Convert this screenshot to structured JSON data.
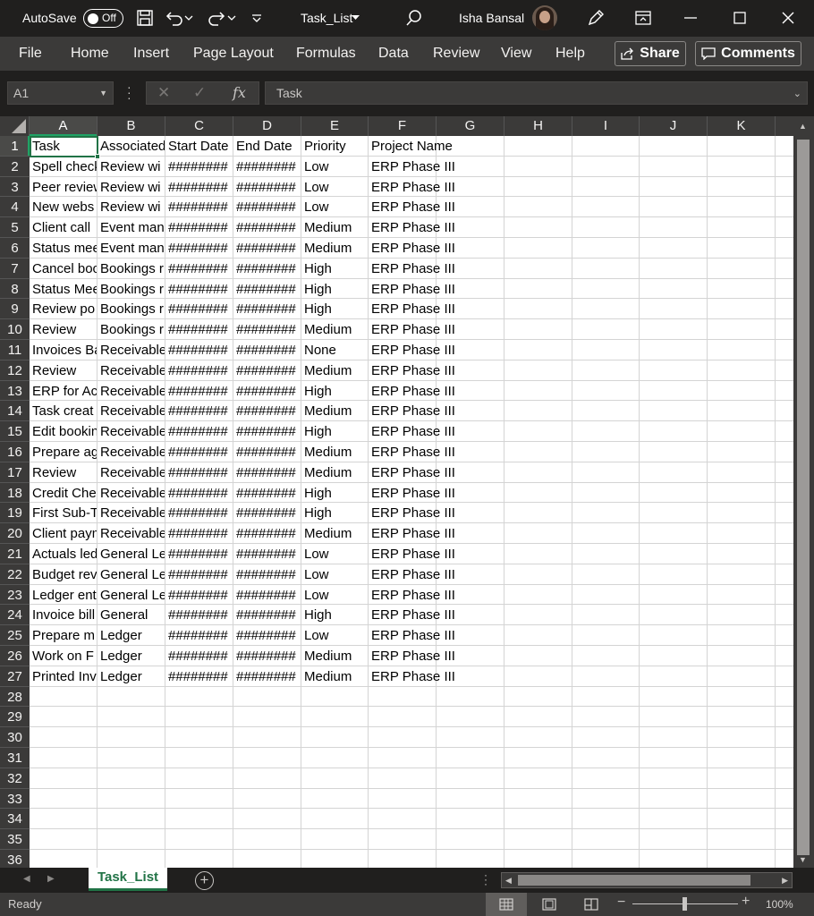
{
  "titlebar": {
    "autosave_label": "AutoSave",
    "autosave_state": "Off",
    "file_name": "Task_List",
    "user_name": "Isha Bansal"
  },
  "menu": {
    "items": [
      "File",
      "Home",
      "Insert",
      "Page Layout",
      "Formulas",
      "Data",
      "Review",
      "View",
      "Help"
    ],
    "share_label": "Share",
    "comments_label": "Comments"
  },
  "formula_bar": {
    "name_box": "A1",
    "formula_value": "Task",
    "fx_label": "fx"
  },
  "sheet": {
    "columns": [
      "A",
      "B",
      "C",
      "D",
      "E",
      "F",
      "G",
      "H",
      "I",
      "J",
      "K"
    ],
    "selected_column": "A",
    "selected_row": 1,
    "row_count": 36,
    "rows": [
      [
        "Task",
        "Associated",
        "Start Date",
        "End Date",
        "Priority",
        "Project Name"
      ],
      [
        "Spell check",
        "Review wi",
        "########",
        "########",
        "Low",
        "ERP Phase III"
      ],
      [
        "Peer review",
        "Review wi",
        "########",
        "########",
        "Low",
        "ERP Phase III"
      ],
      [
        "New webs",
        "Review wi",
        "########",
        "########",
        "Low",
        "ERP Phase III"
      ],
      [
        "Client call",
        "Event man",
        "########",
        "########",
        "Medium",
        "ERP Phase III"
      ],
      [
        "Status mee",
        "Event man",
        "########",
        "########",
        "Medium",
        "ERP Phase III"
      ],
      [
        "Cancel boo",
        "Bookings r",
        "########",
        "########",
        "High",
        "ERP Phase III"
      ],
      [
        "Status Mee",
        "Bookings r",
        "########",
        "########",
        "High",
        "ERP Phase III"
      ],
      [
        "Review po",
        "Bookings r",
        "########",
        "########",
        "High",
        "ERP Phase III"
      ],
      [
        "Review",
        "Bookings r",
        "########",
        "########",
        "Medium",
        "ERP Phase III"
      ],
      [
        "Invoices Ba",
        "Receivable",
        "########",
        "########",
        "None",
        "ERP Phase III"
      ],
      [
        "Review",
        "Receivable",
        "########",
        "########",
        "Medium",
        "ERP Phase III"
      ],
      [
        "ERP for Ac",
        "Receivable",
        "########",
        "########",
        "High",
        "ERP Phase III"
      ],
      [
        "Task creat",
        "Receivable",
        "########",
        "########",
        "Medium",
        "ERP Phase III"
      ],
      [
        "Edit bookin",
        "Receivable",
        "########",
        "########",
        "High",
        "ERP Phase III"
      ],
      [
        "Prepare ag",
        "Receivable",
        "########",
        "########",
        "Medium",
        "ERP Phase III"
      ],
      [
        "Review",
        "Receivable",
        "########",
        "########",
        "Medium",
        "ERP Phase III"
      ],
      [
        "Credit Che",
        "Receivable",
        "########",
        "########",
        "High",
        "ERP Phase III"
      ],
      [
        "First Sub-T",
        "Receivable",
        "########",
        "########",
        "High",
        "ERP Phase III"
      ],
      [
        "Client paym",
        "Receivable",
        "########",
        "########",
        "Medium",
        "ERP Phase III"
      ],
      [
        "Actuals led",
        "General Le",
        "########",
        "########",
        "Low",
        "ERP Phase III"
      ],
      [
        "Budget rev",
        "General Le",
        "########",
        "########",
        "Low",
        "ERP Phase III"
      ],
      [
        "Ledger ent",
        "General Le",
        "########",
        "########",
        "Low",
        "ERP Phase III"
      ],
      [
        "Invoice bill",
        "General",
        "########",
        "########",
        "High",
        "ERP Phase III"
      ],
      [
        "Prepare m",
        "Ledger",
        "########",
        "########",
        "Low",
        "ERP Phase III"
      ],
      [
        "Work on F",
        "Ledger",
        "########",
        "########",
        "Medium",
        "ERP Phase III"
      ],
      [
        "Printed Inv",
        "Ledger",
        "########",
        "########",
        "Medium",
        "ERP Phase III"
      ]
    ]
  },
  "tabs": {
    "sheets": [
      "Task_List"
    ],
    "active": "Task_List"
  },
  "status": {
    "text": "Ready",
    "zoom": "100%"
  },
  "colors": {
    "accent": "#217346",
    "titlebar_bg": "#201f1e",
    "menubar_bg": "#3b3a39"
  }
}
